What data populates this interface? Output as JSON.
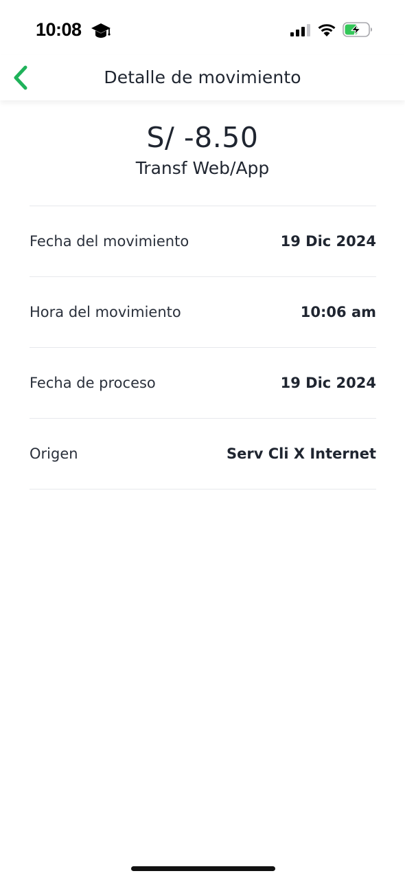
{
  "status_bar": {
    "time": "10:08",
    "extra_icon": "graduation-cap-icon",
    "signal_icon": "cellular-signal-icon",
    "wifi_icon": "wifi-icon",
    "battery_icon": "battery-charging-icon",
    "battery_level": 0.55,
    "battery_color": "#34c759"
  },
  "header": {
    "back_icon": "chevron-left-icon",
    "title": "Detalle de movimiento"
  },
  "summary": {
    "amount": "S/ -8.50",
    "description": "Transf Web/App"
  },
  "details": [
    {
      "label": "Fecha del movimiento",
      "value": "19 Dic 2024"
    },
    {
      "label": "Hora del movimiento",
      "value": "10:06 am"
    },
    {
      "label": "Fecha de proceso",
      "value": "19 Dic 2024"
    },
    {
      "label": "Origen",
      "value": "Serv Cli X Internet"
    }
  ],
  "colors": {
    "accent": "#1fb25a",
    "text_primary": "#1f2530",
    "divider": "#e6e8ec"
  }
}
